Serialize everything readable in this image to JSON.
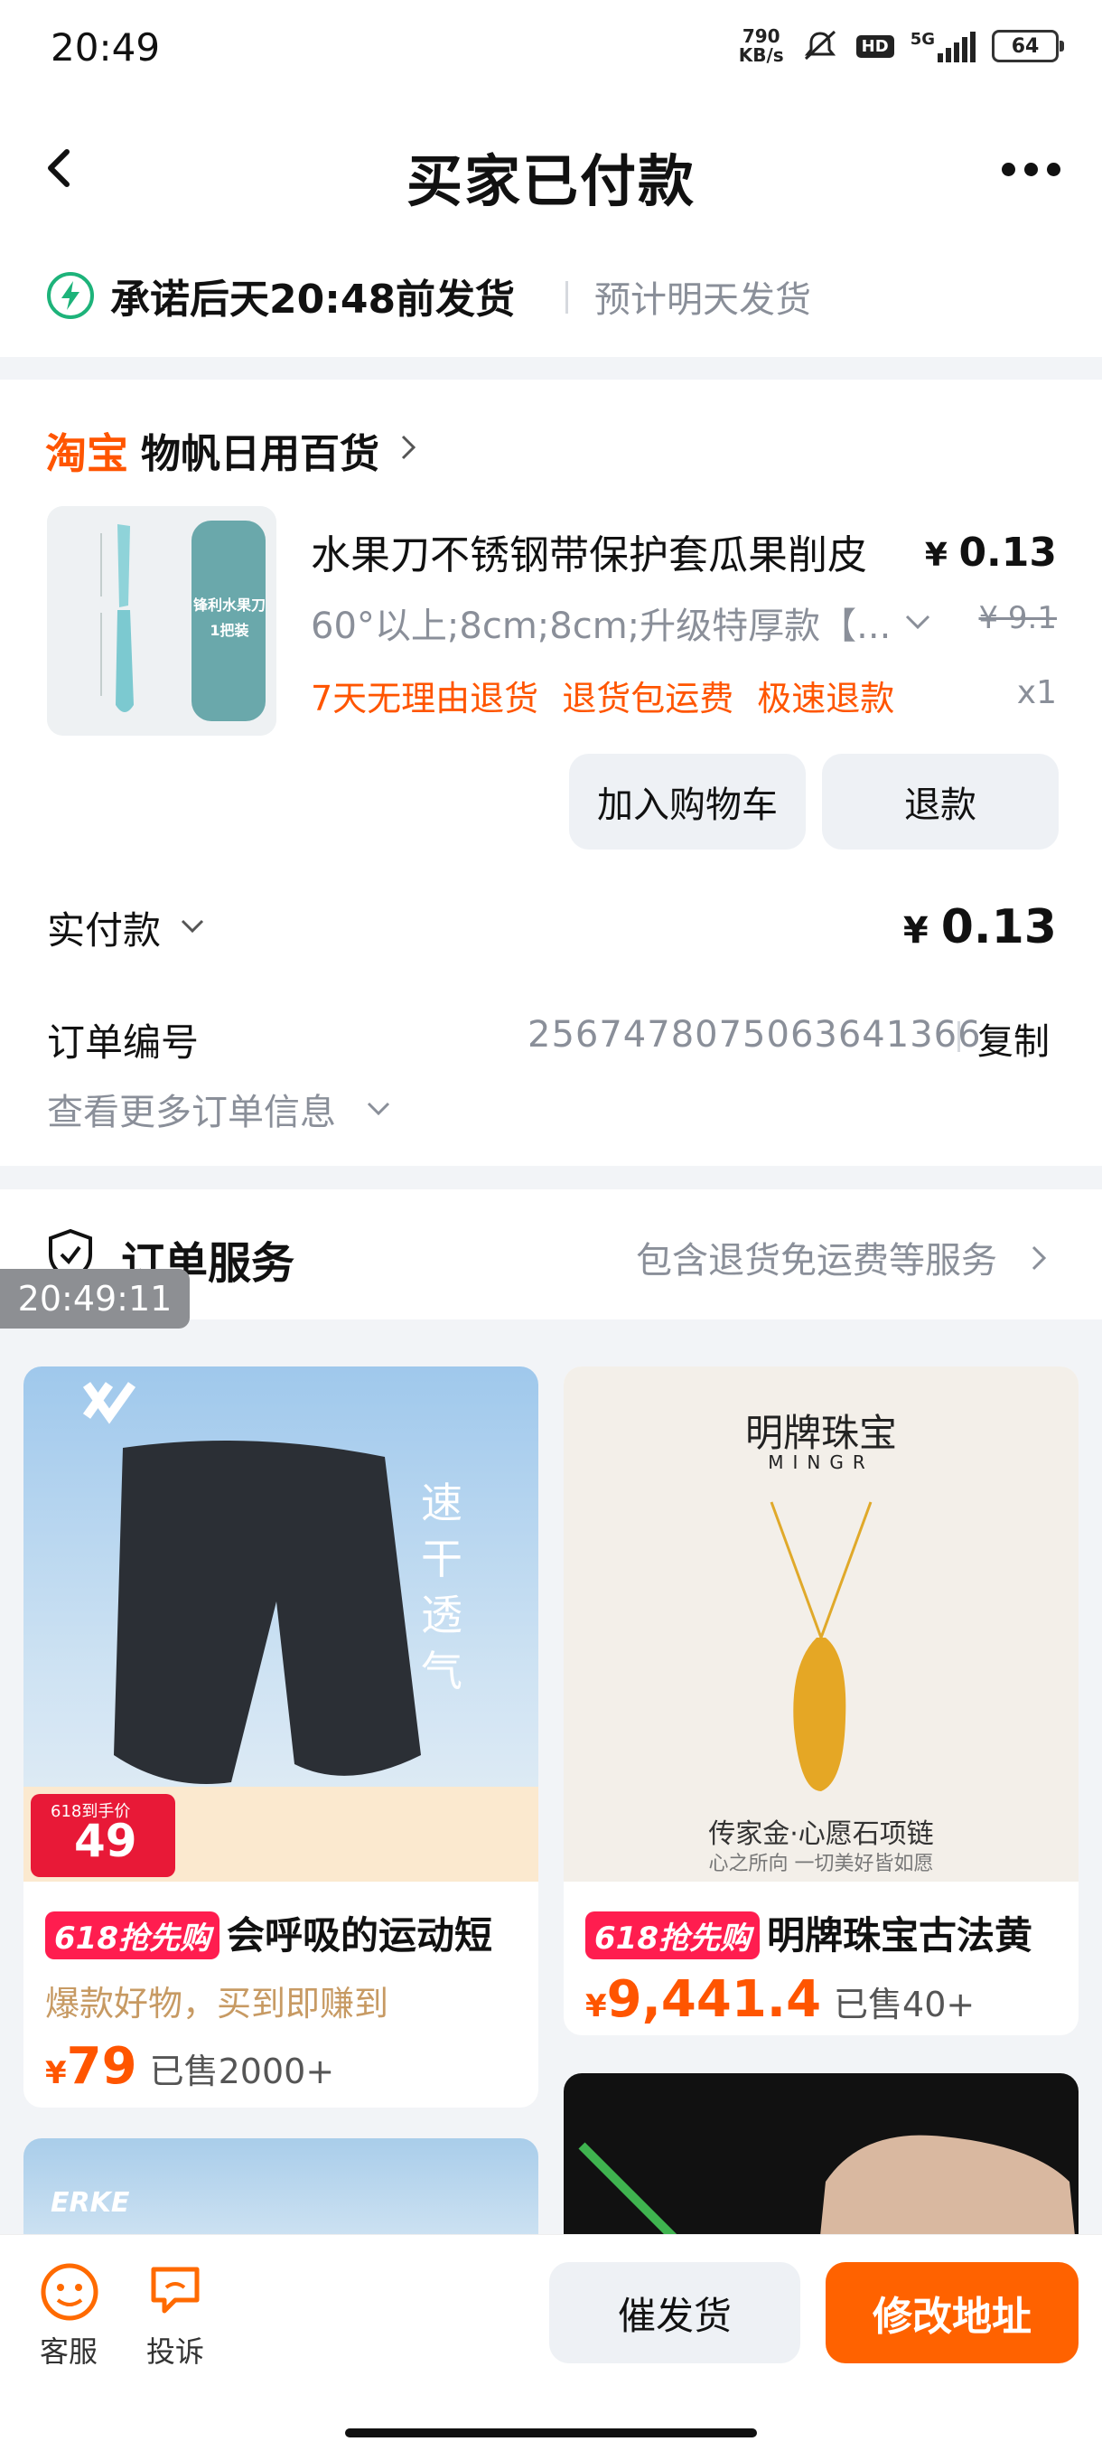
{
  "status_bar": {
    "time": "20:49",
    "speed": "790\nKB/s",
    "network": "5G",
    "hd": "HD",
    "battery": "64"
  },
  "header": {
    "title": "买家已付款"
  },
  "promise": {
    "text": "承诺后天20:48前发货",
    "sub": "预计明天发货"
  },
  "shop": {
    "logo": "淘宝",
    "name": "物帆日用百货"
  },
  "product": {
    "title": "水果刀不锈钢带保护套瓜果削皮",
    "price_currency": "¥",
    "price": "0.13",
    "spec": "60°以上;8cm;8cm;升级特厚款【...",
    "original_price": "¥ 9.1",
    "tags": [
      "7天无理由退货",
      "退货包运费",
      "极速退款"
    ],
    "qty": "x1",
    "thumb_label": "锋利水果刀\n1把装"
  },
  "actions": {
    "add_cart": "加入购物车",
    "refund": "退款"
  },
  "payment": {
    "label": "实付款",
    "currency": "¥",
    "value": "0.13"
  },
  "order": {
    "no_label": "订单编号",
    "no_value": "2567478075063641366",
    "copy": "复制",
    "more": "查看更多订单信息"
  },
  "service": {
    "title": "订单服务",
    "sub": "包含退货免运费等服务"
  },
  "timestamp": "20:49:11",
  "feed": [
    {
      "badge": "618抢先购",
      "title": "会呼吸的运动短",
      "sub": "爆款好物，买到即赚到",
      "currency": "¥",
      "price": "79",
      "sold": "已售2000+",
      "promo_price": "49",
      "promo_label": "618到手价",
      "img_text": "速干 透气"
    },
    {
      "badge": "618抢先购",
      "title": "明牌珠宝古法黄",
      "currency": "¥",
      "price": "9,441.4",
      "sold": "已售40+",
      "brand": "明牌珠宝",
      "brand_en": "MINGR",
      "img_caption": "传家金·心愿石项链",
      "img_caption2": "心之所向 一切美好皆如愿"
    },
    {
      "brand": "ERKE"
    }
  ],
  "bottom": {
    "service": "客服",
    "complain": "投诉",
    "urge": "催发货",
    "change_addr": "修改地址"
  },
  "colors": {
    "accent": "#ff5500",
    "primary_btn": "#ff6200",
    "badge": "#ff1d4f",
    "green": "#1db37a"
  }
}
